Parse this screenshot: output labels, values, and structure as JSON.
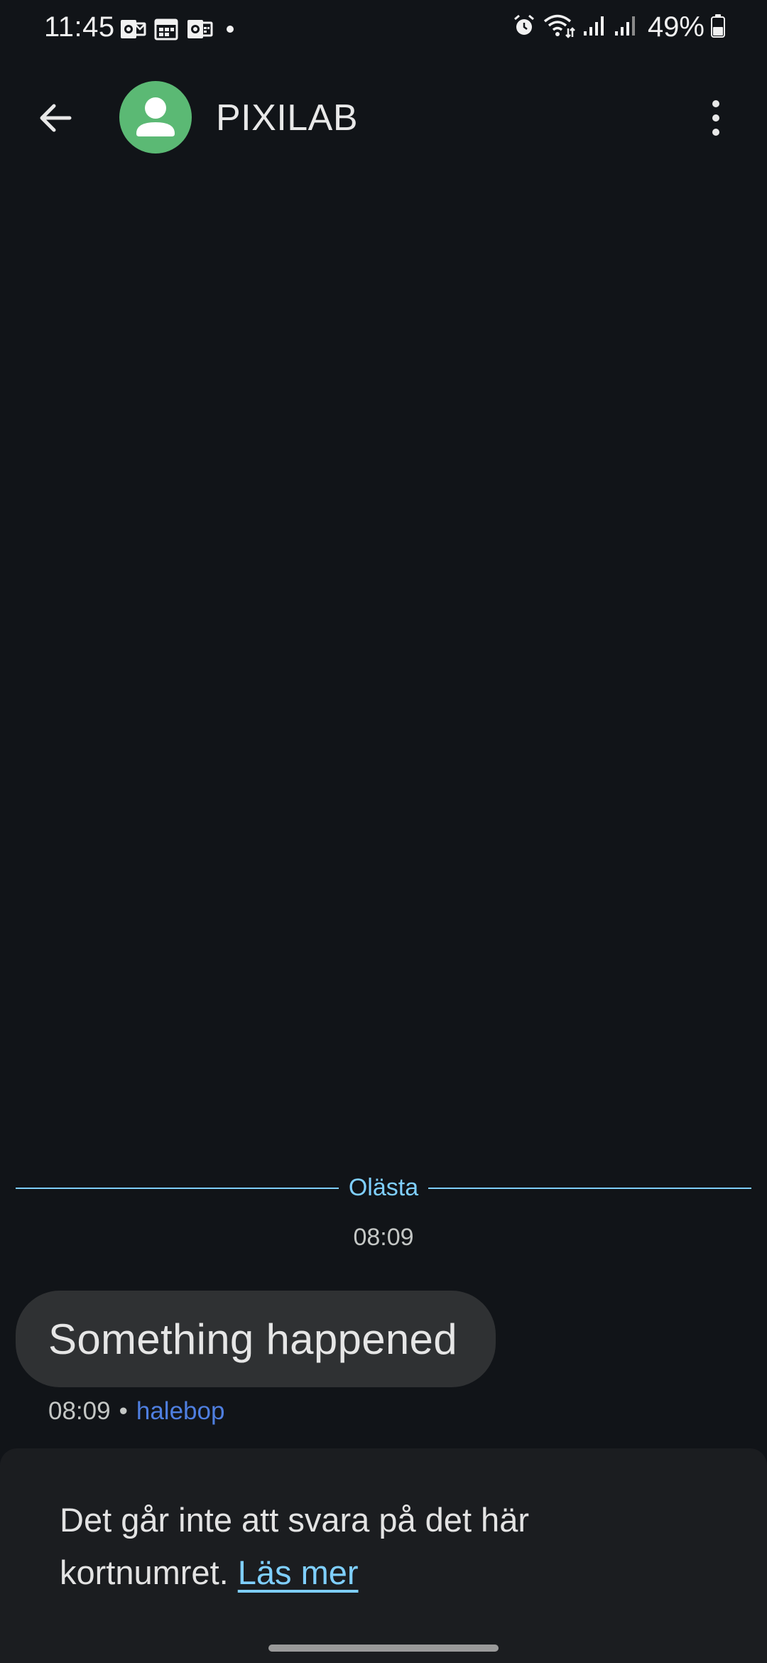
{
  "status_bar": {
    "time": "11:45",
    "battery": "49%",
    "left_icons": [
      "outlook-icon",
      "calendar-icon",
      "outlook-calendar-icon",
      "notification-dot-icon"
    ],
    "right_icons": [
      "alarm-icon",
      "wifi-icon",
      "signal-icon",
      "signal-icon",
      "battery-icon"
    ]
  },
  "app_bar": {
    "contact_name": "PIXILAB",
    "back_icon": "arrow-back-icon",
    "more_icon": "more-vertical-icon",
    "avatar_color": "#5bb974"
  },
  "conversation": {
    "unread_label": "Olästa",
    "time_header": "08:09",
    "messages": [
      {
        "text": "Something happened",
        "time": "08:09",
        "separator": "•",
        "sender": "halebop"
      }
    ]
  },
  "bottom_notice": {
    "text": "Det går inte att svara på det här kortnumret.",
    "link": "Läs mer"
  },
  "colors": {
    "background": "#111418",
    "accent": "#7fcfff",
    "bubble": "#2f3133",
    "sender": "#4f7fe0"
  }
}
